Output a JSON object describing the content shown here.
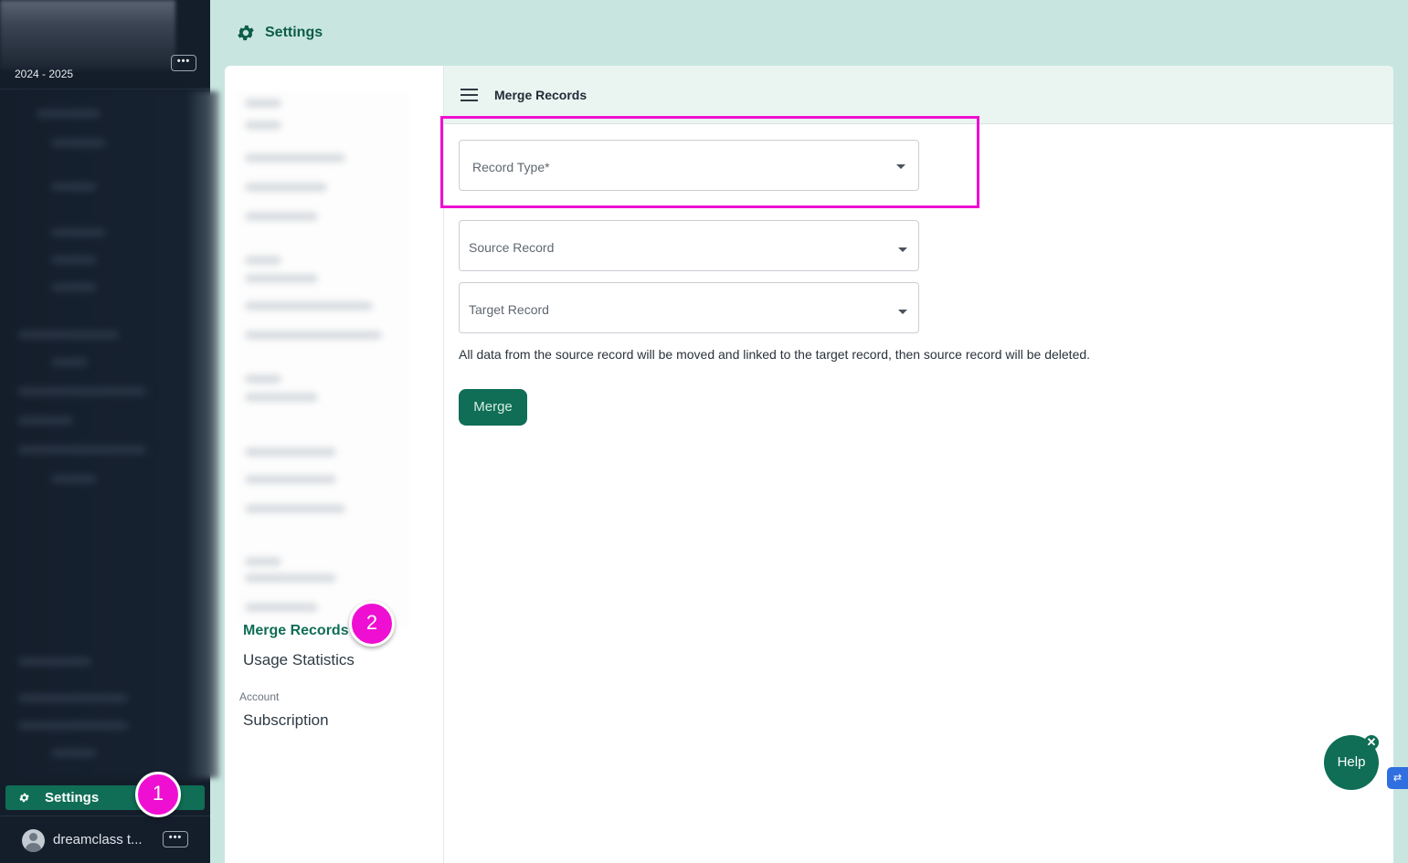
{
  "sidebar": {
    "year": "2024 - 2025",
    "top_menu_icon": "ellipsis-icon",
    "settings_label": "Settings",
    "settings_icon": "gear-icon",
    "user_name": "dreamclass t...",
    "user_menu_icon": "ellipsis-icon"
  },
  "header": {
    "title": "Settings",
    "icon": "gear-icon"
  },
  "settings_nav": {
    "items": [
      {
        "label": "Merge Records",
        "active": true
      },
      {
        "label": "Usage Statistics",
        "active": false
      }
    ],
    "account_section": "Account",
    "account_items": [
      {
        "label": "Subscription"
      }
    ]
  },
  "content": {
    "title": "Merge Records",
    "menu_icon": "hamburger-icon",
    "record_type_placeholder": "Record Type*",
    "source_record_placeholder": "Source Record",
    "target_record_placeholder": "Target Record",
    "info_text": "All data from the source record will be moved and linked to the target record, then source record will be deleted.",
    "merge_button": "Merge"
  },
  "annotations": {
    "step1": "1",
    "step2": "2",
    "highlight_color": "#ee0fd2"
  },
  "help": {
    "label": "Help",
    "close": "✕"
  },
  "colors": {
    "brand": "#0f6e55",
    "sidebar_bg": "#141e2b",
    "page_bg": "#c8e6df"
  }
}
